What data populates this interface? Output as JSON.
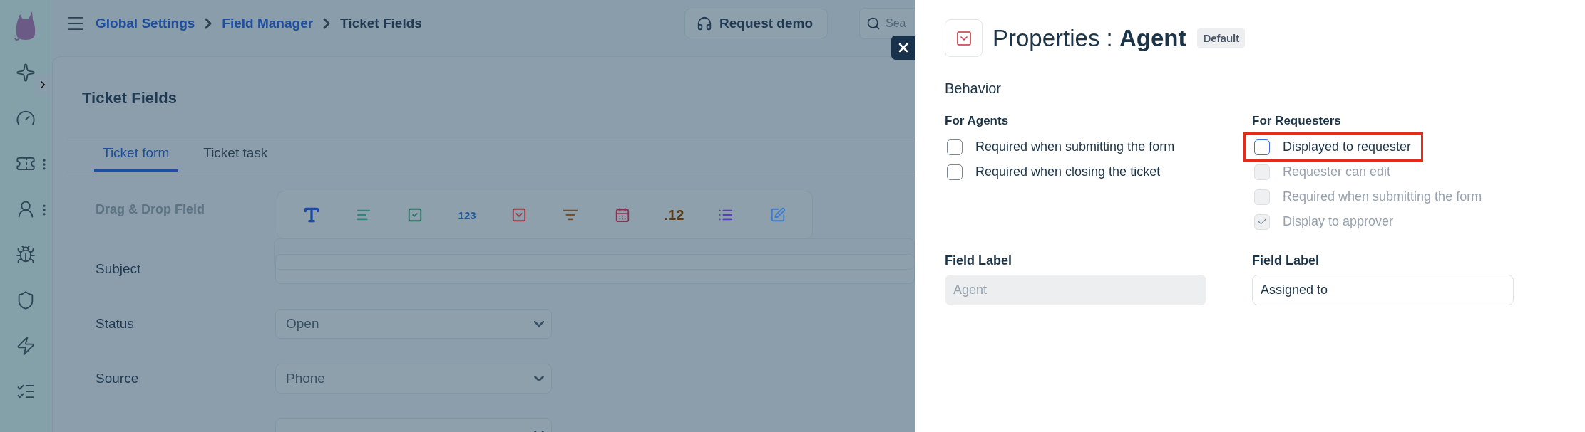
{
  "sidebar": {
    "items": [
      {
        "menu": false
      },
      {
        "menu": false
      },
      {
        "menu": true
      },
      {
        "menu": true
      },
      {
        "menu": false
      },
      {
        "menu": false
      },
      {
        "menu": false
      },
      {
        "menu": false
      }
    ]
  },
  "header": {
    "breadcrumbs": [
      {
        "label": "Global Settings",
        "link": true
      },
      {
        "label": "Field Manager",
        "link": true
      },
      {
        "label": "Ticket Fields",
        "link": false
      }
    ],
    "request_demo": "Request demo",
    "search": {
      "placeholder": "Sea"
    }
  },
  "page": {
    "title": "Ticket Fields",
    "tabs": [
      {
        "label": "Ticket form",
        "selected": true
      },
      {
        "label": "Ticket task",
        "selected": false
      }
    ],
    "drag_drop": {
      "label": "Drag & Drop Field",
      "items": [
        {
          "kind": "icon"
        },
        {
          "kind": "icon"
        },
        {
          "kind": "icon"
        },
        {
          "kind": "text",
          "label": "123"
        },
        {
          "kind": "icon"
        },
        {
          "kind": "icon"
        },
        {
          "kind": "icon"
        },
        {
          "kind": "text",
          "label": ".12"
        },
        {
          "kind": "icon"
        },
        {
          "kind": "icon"
        }
      ]
    },
    "fields": [
      {
        "label": "Subject",
        "kind": "text"
      },
      {
        "label": "Status",
        "kind": "select",
        "value": "Open"
      },
      {
        "label": "Source",
        "kind": "select",
        "value": "Phone"
      },
      {
        "kind": "select"
      }
    ]
  },
  "panel": {
    "title_prefix": "Properties :",
    "title_name": "Agent",
    "badge": "Default",
    "section": "Behavior",
    "groups": [
      {
        "heading": "For Agents",
        "options": [
          {
            "label": "Required when submitting the form",
            "checked": false,
            "disabled": false,
            "focused": false,
            "highlighted": false
          },
          {
            "label": "Required when closing the ticket",
            "checked": false,
            "disabled": false,
            "focused": false,
            "highlighted": false
          }
        ]
      },
      {
        "heading": "For Requesters",
        "options": [
          {
            "label": "Displayed to requester",
            "checked": false,
            "disabled": false,
            "focused": true,
            "highlighted": true
          },
          {
            "label": "Requester can edit",
            "checked": false,
            "disabled": true,
            "focused": false,
            "highlighted": false
          },
          {
            "label": "Required when submitting the form",
            "checked": false,
            "disabled": true,
            "focused": false,
            "highlighted": false
          },
          {
            "label": "Display to approver",
            "checked": true,
            "disabled": true,
            "focused": false,
            "highlighted": false
          }
        ]
      }
    ],
    "labels": [
      {
        "heading": "Field Label",
        "value": "Agent",
        "disabled": true
      },
      {
        "heading": "Field Label",
        "value": "Assigned to",
        "disabled": false
      }
    ]
  }
}
